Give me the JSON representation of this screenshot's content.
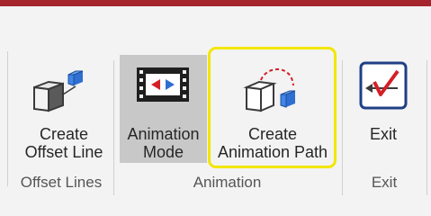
{
  "ribbon": {
    "groups": [
      {
        "label": "Offset Lines",
        "buttons": [
          {
            "line1": "Create",
            "line2": "Offset Line",
            "icon": "offset-line-icon"
          }
        ]
      },
      {
        "label": "Animation",
        "buttons": [
          {
            "line1": "Animation",
            "line2": "Mode",
            "icon": "film-strip-icon",
            "state": "selected"
          },
          {
            "line1": "Create",
            "line2": "Animation Path",
            "icon": "animation-path-icon",
            "state": "highlighted"
          }
        ]
      },
      {
        "label": "Exit",
        "buttons": [
          {
            "line1": "Exit",
            "line2": "",
            "icon": "exit-check-icon"
          }
        ]
      }
    ]
  },
  "colors": {
    "top_bar": "#a4262c",
    "ribbon_bg": "#f3f3f3",
    "selected_bg": "#c8c8c8",
    "highlight_border": "#f2e600",
    "accent_blue": "#2f6fd1",
    "accent_red": "#d32027",
    "exit_border": "#1f3f86"
  }
}
